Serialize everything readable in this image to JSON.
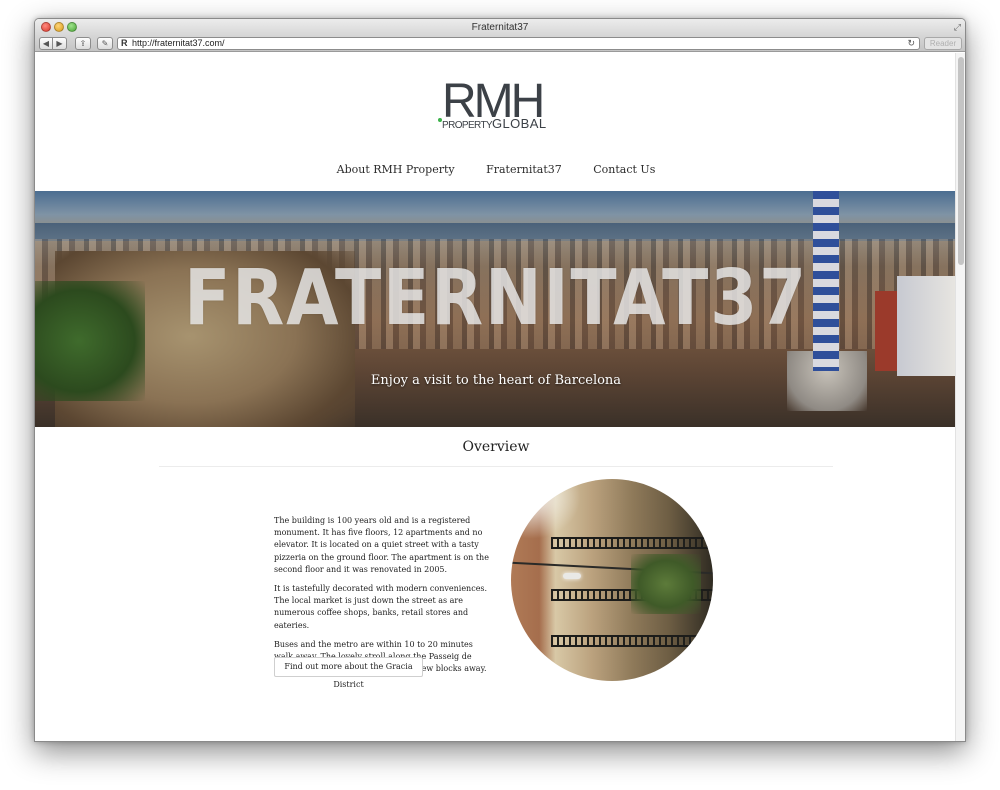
{
  "browser": {
    "window_title": "Fraternitat37",
    "url": "http://fraternitat37.com/",
    "reader_label": "Reader",
    "back_icon": "◀",
    "forward_icon": "▶",
    "share_icon": "⇪",
    "tools_icon": "✎",
    "favicon": "R",
    "reload_icon": "↻",
    "fullscreen_icon": "⤢"
  },
  "logo": {
    "main": "RMH",
    "sub_property": "PROPERTY",
    "sub_global": "GLOBAL",
    "accent_color": "#3cb24a"
  },
  "nav": {
    "items": [
      {
        "label": "About RMH Property"
      },
      {
        "label": "Fraternitat37"
      },
      {
        "label": "Contact Us"
      }
    ]
  },
  "hero": {
    "title": "FRATERNITAT37",
    "subtitle": "Enjoy a visit to the heart of Barcelona"
  },
  "overview": {
    "title": "Overview",
    "paragraphs": [
      "The building is 100 years old and is a registered monument. It has five floors, 12 apartments and no elevator. It is located on a quiet street with a tasty pizzeria on the ground floor. The apartment is on the second floor and it was renovated in 2005.",
      "It is tastefully decorated with modern conveniences. The local market is just down the street as are numerous coffee shops, banks, retail stores and eateries.",
      "Buses and the metro are within 10 to 20 minutes walk away. The lovely stroll along the Passeig de Gracia to Placa Catalunya begins a few blocks away."
    ],
    "button_label": "Find out more about the Gracia District"
  }
}
